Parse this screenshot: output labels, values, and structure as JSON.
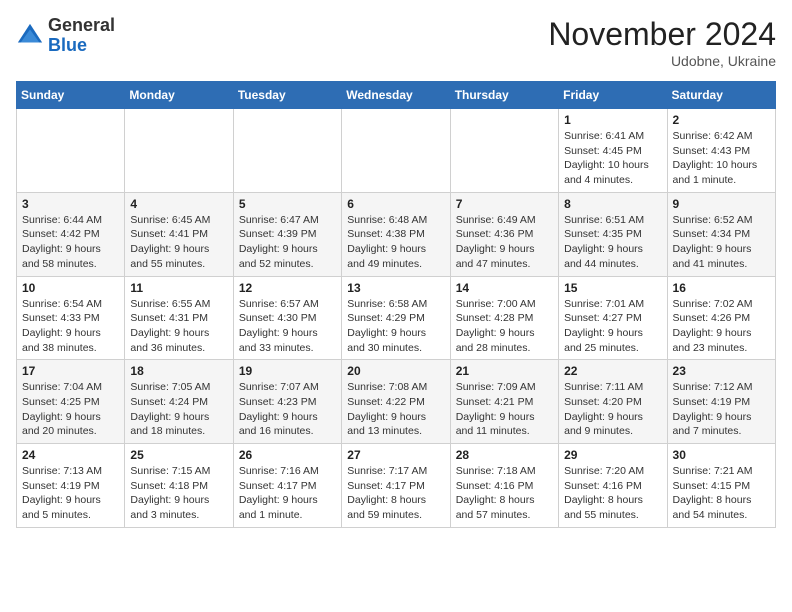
{
  "header": {
    "logo_general": "General",
    "logo_blue": "Blue",
    "month_title": "November 2024",
    "location": "Udobne, Ukraine"
  },
  "weekdays": [
    "Sunday",
    "Monday",
    "Tuesday",
    "Wednesday",
    "Thursday",
    "Friday",
    "Saturday"
  ],
  "weeks": [
    [
      {
        "day": "",
        "info": ""
      },
      {
        "day": "",
        "info": ""
      },
      {
        "day": "",
        "info": ""
      },
      {
        "day": "",
        "info": ""
      },
      {
        "day": "",
        "info": ""
      },
      {
        "day": "1",
        "info": "Sunrise: 6:41 AM\nSunset: 4:45 PM\nDaylight: 10 hours\nand 4 minutes."
      },
      {
        "day": "2",
        "info": "Sunrise: 6:42 AM\nSunset: 4:43 PM\nDaylight: 10 hours\nand 1 minute."
      }
    ],
    [
      {
        "day": "3",
        "info": "Sunrise: 6:44 AM\nSunset: 4:42 PM\nDaylight: 9 hours\nand 58 minutes."
      },
      {
        "day": "4",
        "info": "Sunrise: 6:45 AM\nSunset: 4:41 PM\nDaylight: 9 hours\nand 55 minutes."
      },
      {
        "day": "5",
        "info": "Sunrise: 6:47 AM\nSunset: 4:39 PM\nDaylight: 9 hours\nand 52 minutes."
      },
      {
        "day": "6",
        "info": "Sunrise: 6:48 AM\nSunset: 4:38 PM\nDaylight: 9 hours\nand 49 minutes."
      },
      {
        "day": "7",
        "info": "Sunrise: 6:49 AM\nSunset: 4:36 PM\nDaylight: 9 hours\nand 47 minutes."
      },
      {
        "day": "8",
        "info": "Sunrise: 6:51 AM\nSunset: 4:35 PM\nDaylight: 9 hours\nand 44 minutes."
      },
      {
        "day": "9",
        "info": "Sunrise: 6:52 AM\nSunset: 4:34 PM\nDaylight: 9 hours\nand 41 minutes."
      }
    ],
    [
      {
        "day": "10",
        "info": "Sunrise: 6:54 AM\nSunset: 4:33 PM\nDaylight: 9 hours\nand 38 minutes."
      },
      {
        "day": "11",
        "info": "Sunrise: 6:55 AM\nSunset: 4:31 PM\nDaylight: 9 hours\nand 36 minutes."
      },
      {
        "day": "12",
        "info": "Sunrise: 6:57 AM\nSunset: 4:30 PM\nDaylight: 9 hours\nand 33 minutes."
      },
      {
        "day": "13",
        "info": "Sunrise: 6:58 AM\nSunset: 4:29 PM\nDaylight: 9 hours\nand 30 minutes."
      },
      {
        "day": "14",
        "info": "Sunrise: 7:00 AM\nSunset: 4:28 PM\nDaylight: 9 hours\nand 28 minutes."
      },
      {
        "day": "15",
        "info": "Sunrise: 7:01 AM\nSunset: 4:27 PM\nDaylight: 9 hours\nand 25 minutes."
      },
      {
        "day": "16",
        "info": "Sunrise: 7:02 AM\nSunset: 4:26 PM\nDaylight: 9 hours\nand 23 minutes."
      }
    ],
    [
      {
        "day": "17",
        "info": "Sunrise: 7:04 AM\nSunset: 4:25 PM\nDaylight: 9 hours\nand 20 minutes."
      },
      {
        "day": "18",
        "info": "Sunrise: 7:05 AM\nSunset: 4:24 PM\nDaylight: 9 hours\nand 18 minutes."
      },
      {
        "day": "19",
        "info": "Sunrise: 7:07 AM\nSunset: 4:23 PM\nDaylight: 9 hours\nand 16 minutes."
      },
      {
        "day": "20",
        "info": "Sunrise: 7:08 AM\nSunset: 4:22 PM\nDaylight: 9 hours\nand 13 minutes."
      },
      {
        "day": "21",
        "info": "Sunrise: 7:09 AM\nSunset: 4:21 PM\nDaylight: 9 hours\nand 11 minutes."
      },
      {
        "day": "22",
        "info": "Sunrise: 7:11 AM\nSunset: 4:20 PM\nDaylight: 9 hours\nand 9 minutes."
      },
      {
        "day": "23",
        "info": "Sunrise: 7:12 AM\nSunset: 4:19 PM\nDaylight: 9 hours\nand 7 minutes."
      }
    ],
    [
      {
        "day": "24",
        "info": "Sunrise: 7:13 AM\nSunset: 4:19 PM\nDaylight: 9 hours\nand 5 minutes."
      },
      {
        "day": "25",
        "info": "Sunrise: 7:15 AM\nSunset: 4:18 PM\nDaylight: 9 hours\nand 3 minutes."
      },
      {
        "day": "26",
        "info": "Sunrise: 7:16 AM\nSunset: 4:17 PM\nDaylight: 9 hours\nand 1 minute."
      },
      {
        "day": "27",
        "info": "Sunrise: 7:17 AM\nSunset: 4:17 PM\nDaylight: 8 hours\nand 59 minutes."
      },
      {
        "day": "28",
        "info": "Sunrise: 7:18 AM\nSunset: 4:16 PM\nDaylight: 8 hours\nand 57 minutes."
      },
      {
        "day": "29",
        "info": "Sunrise: 7:20 AM\nSunset: 4:16 PM\nDaylight: 8 hours\nand 55 minutes."
      },
      {
        "day": "30",
        "info": "Sunrise: 7:21 AM\nSunset: 4:15 PM\nDaylight: 8 hours\nand 54 minutes."
      }
    ]
  ]
}
